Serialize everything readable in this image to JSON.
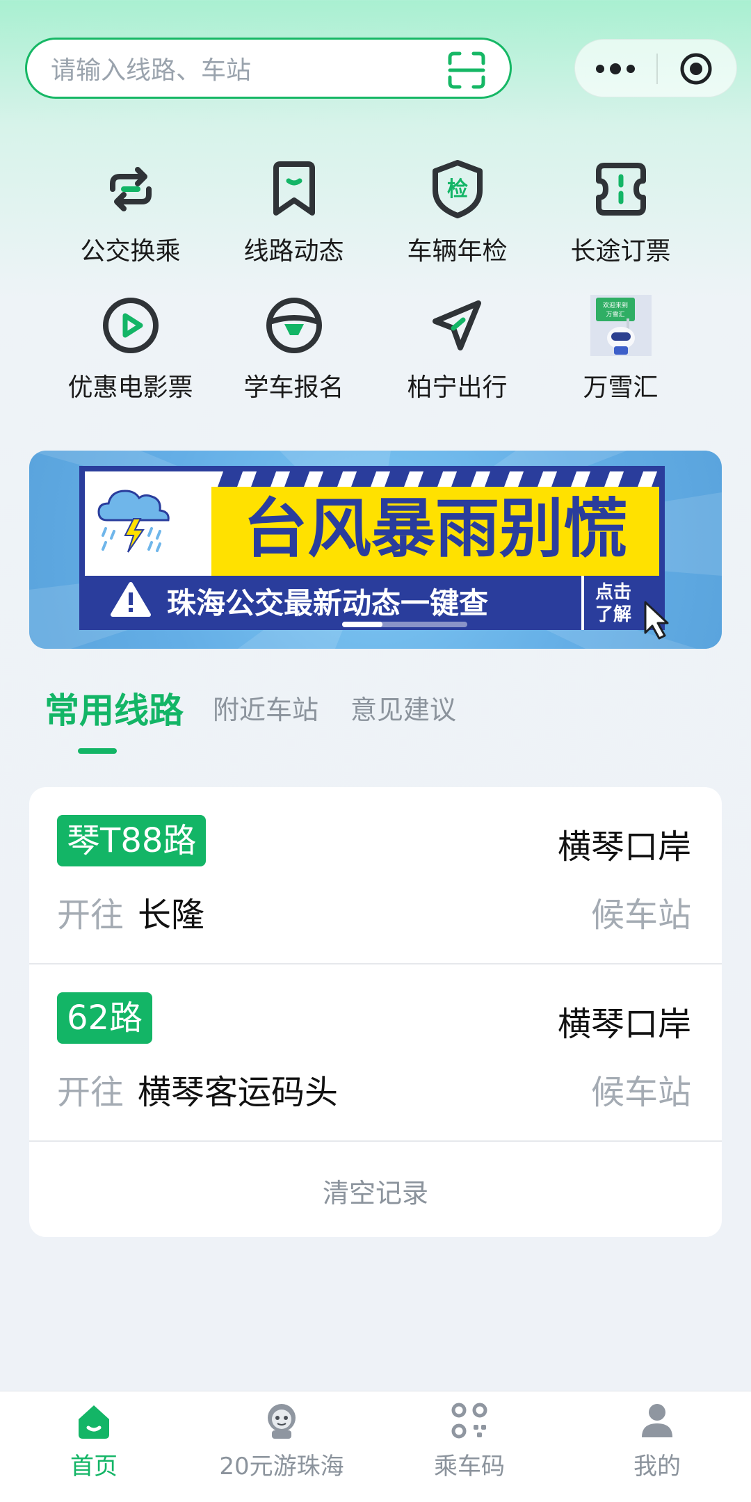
{
  "search": {
    "placeholder": "请输入线路、车站"
  },
  "grid": [
    {
      "label": "公交换乘",
      "icon": "transfer-icon"
    },
    {
      "label": "线路动态",
      "icon": "bookmark-icon"
    },
    {
      "label": "车辆年检",
      "icon": "inspection-shield-icon",
      "icon_text": "检"
    },
    {
      "label": "长途订票",
      "icon": "ticket-icon"
    },
    {
      "label": "优惠电影票",
      "icon": "play-icon"
    },
    {
      "label": "学车报名",
      "icon": "steering-wheel-icon"
    },
    {
      "label": "柏宁出行",
      "icon": "navigation-icon"
    },
    {
      "label": "万雪汇",
      "icon": "mascot-image",
      "icon_text": "欢迎来到万雪汇"
    }
  ],
  "banner": {
    "title": "台风暴雨别慌",
    "subtitle": "珠海公交最新动态一键查",
    "cta_line1": "点击",
    "cta_line2": "了解"
  },
  "tabs": [
    {
      "label": "常用线路",
      "active": true
    },
    {
      "label": "附近车站",
      "active": false
    },
    {
      "label": "意见建议",
      "active": false
    }
  ],
  "routes": [
    {
      "line": "琴T88路",
      "stop": "横琴口岸",
      "to_label": "开往",
      "to": "长隆",
      "status": "候车站"
    },
    {
      "line": "62路",
      "stop": "横琴口岸",
      "to_label": "开往",
      "to": "横琴客运码头",
      "status": "候车站"
    }
  ],
  "clear_label": "清空记录",
  "nav": [
    {
      "label": "首页",
      "icon": "home-icon",
      "active": true
    },
    {
      "label": "20元游珠海",
      "icon": "mascot-icon",
      "active": false
    },
    {
      "label": "乘车码",
      "icon": "qr-code-icon",
      "active": false
    },
    {
      "label": "我的",
      "icon": "user-icon",
      "active": false
    }
  ],
  "colors": {
    "accent": "#13b566",
    "icon_dark": "#2f3337",
    "banner_title": "#2a3d9c",
    "banner_yellow": "#ffe100"
  }
}
